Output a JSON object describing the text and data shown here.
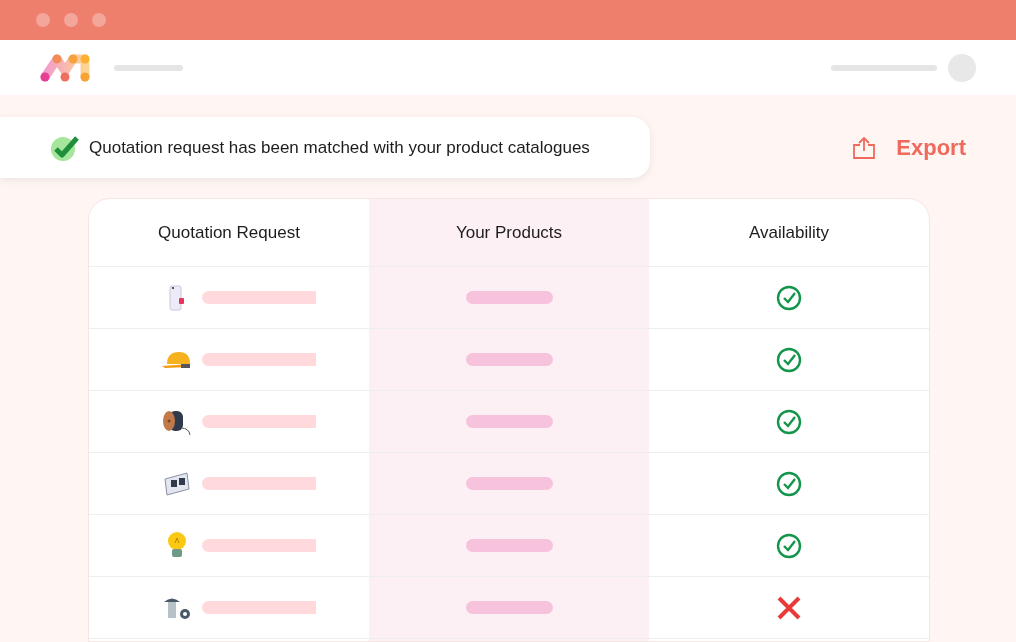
{
  "notification": {
    "text": "Quotation request has been matched with your product catalogues"
  },
  "export_button": {
    "label": "Export"
  },
  "table": {
    "columns": [
      "Quotation Request",
      "Your Products",
      "Availability"
    ],
    "rows": [
      {
        "kind": "breaker",
        "available": true
      },
      {
        "kind": "helmet",
        "available": true
      },
      {
        "kind": "cable-reel",
        "available": true
      },
      {
        "kind": "socket",
        "available": true
      },
      {
        "kind": "bulb",
        "available": true
      },
      {
        "kind": "screw",
        "available": false
      }
    ]
  }
}
